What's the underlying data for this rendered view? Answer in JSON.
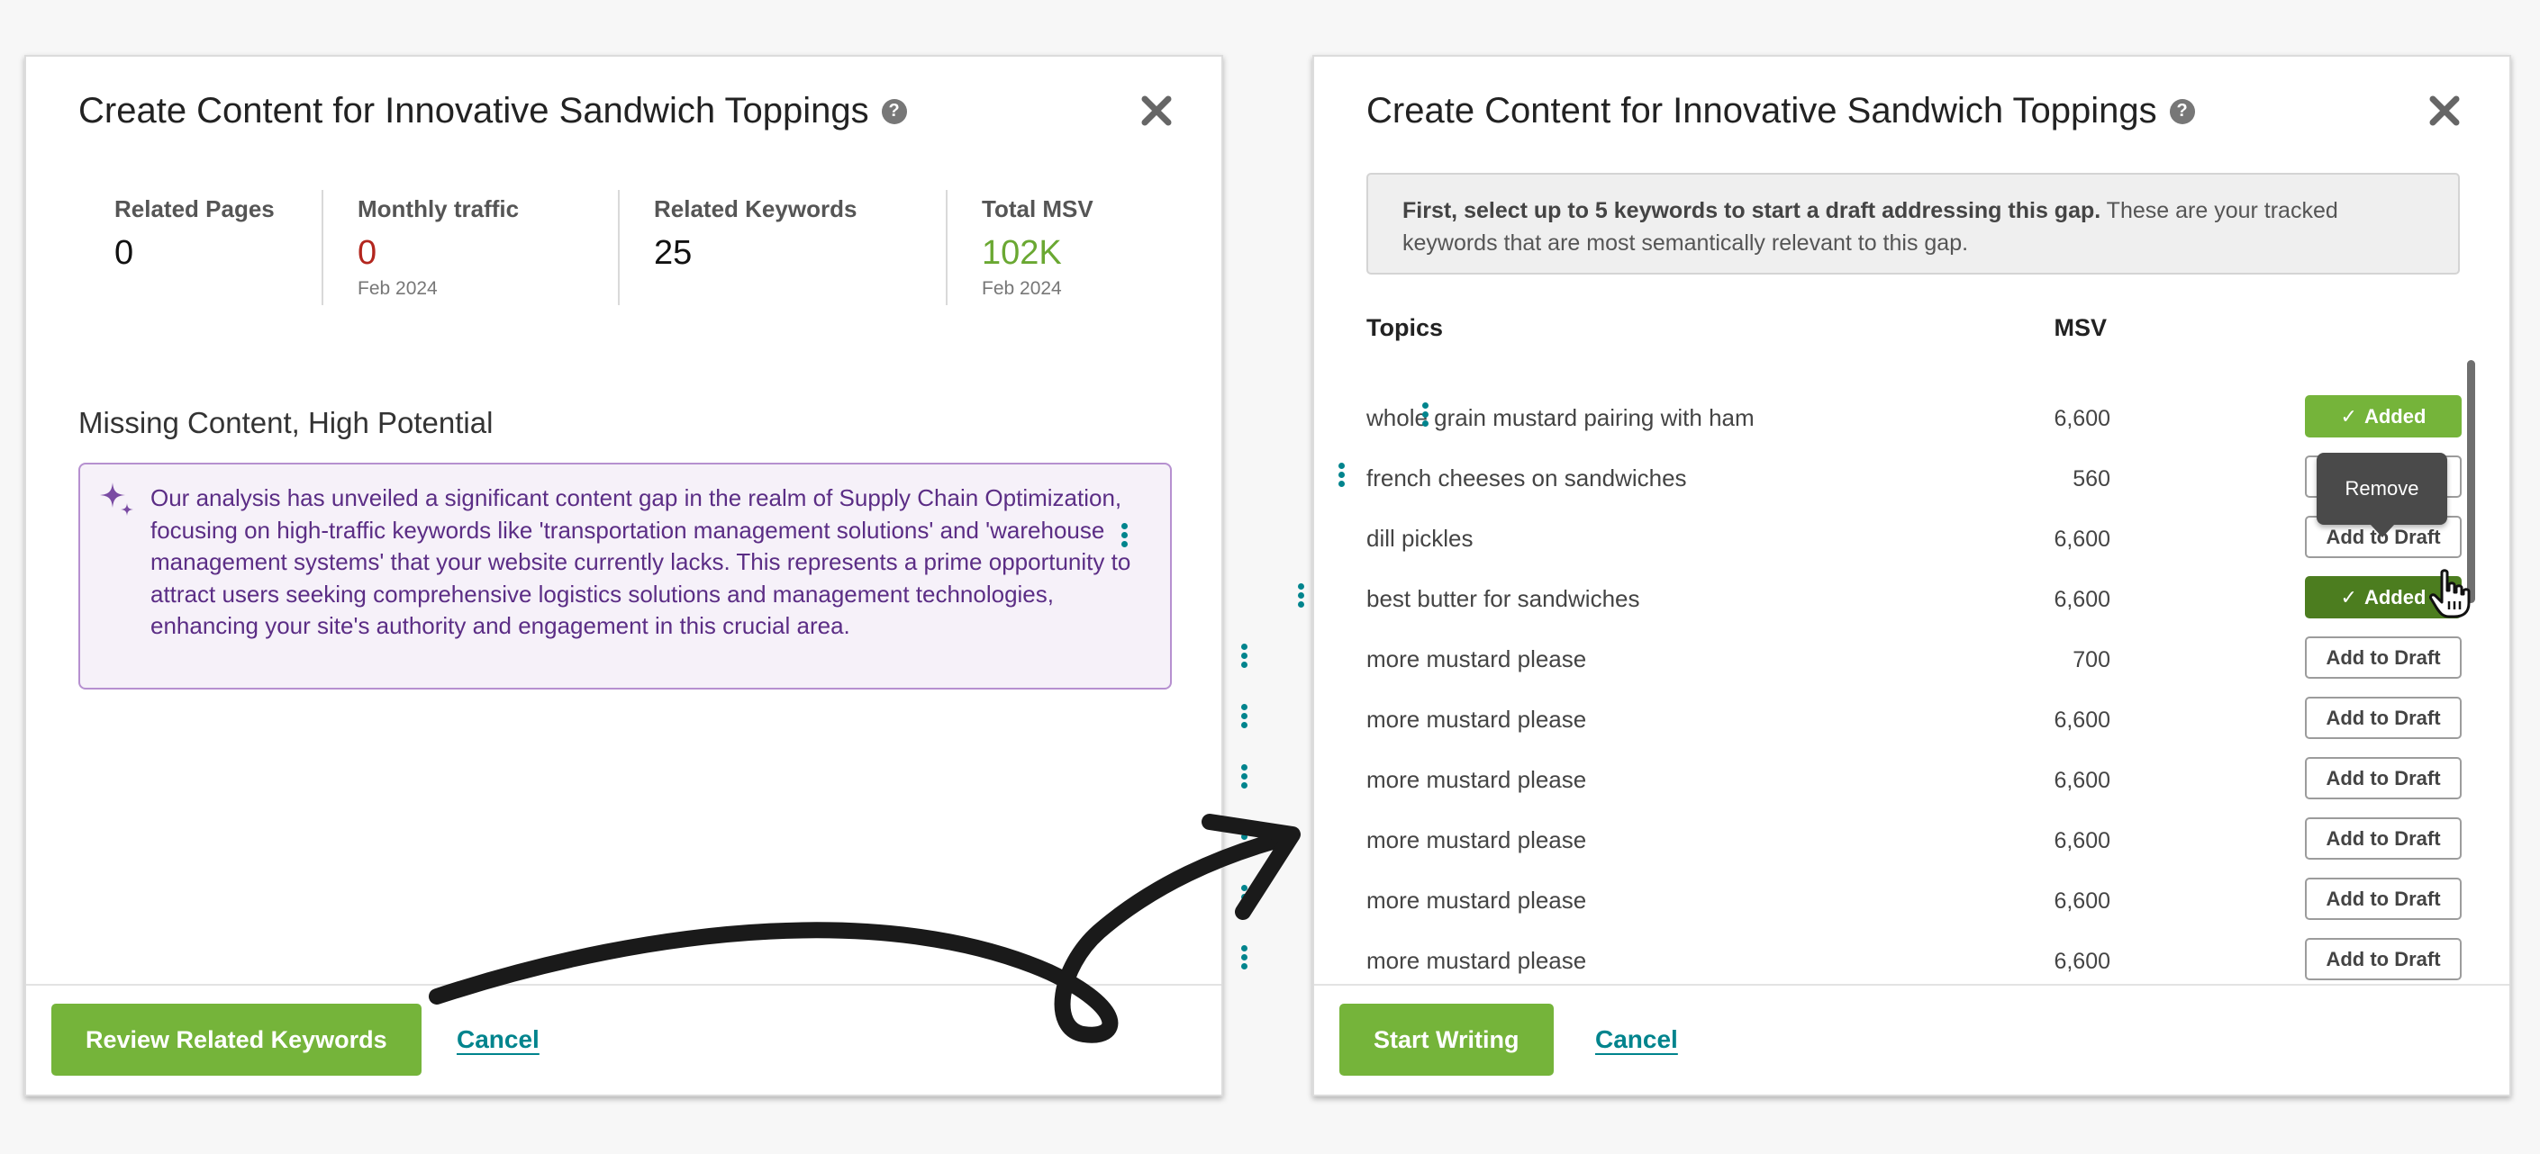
{
  "left_modal": {
    "title": "Create Content for Innovative Sandwich Toppings",
    "help": "?",
    "stats": [
      {
        "label": "Related Pages",
        "value": "0",
        "sub": ""
      },
      {
        "label": "Monthly traffic",
        "value": "0",
        "sub": "Feb 2024"
      },
      {
        "label": "Related Keywords",
        "value": "25",
        "sub": ""
      },
      {
        "label": "Total MSV",
        "value": "102K",
        "sub": "Feb 2024"
      }
    ],
    "section_title": "Missing Content, High Potential",
    "insight": "Our analysis has unveiled a significant content gap in the realm of Supply Chain Optimization, focusing on high-traffic keywords like 'transportation management solutions' and 'warehouse management systems' that your website currently lacks. This represents a prime opportunity to attract users seeking comprehensive logistics solutions and management technologies, enhancing your site's authority and engagement in this crucial area.",
    "primary_button": "Review Related Keywords",
    "cancel": "Cancel"
  },
  "right_modal": {
    "title": "Create Content for Innovative Sandwich Toppings",
    "help": "?",
    "info_bold": "First, select up to 5 keywords to start a draft addressing this gap.",
    "info_rest": " These are your tracked keywords that are most semantically relevant to this gap.",
    "col_topics": "Topics",
    "col_msv": "MSV",
    "rows": [
      {
        "topic": "whole grain mustard pairing with ham",
        "msv": "6,600",
        "action": "Added"
      },
      {
        "topic": "french cheeses on sandwiches",
        "msv": "560",
        "action": "Add to Draft"
      },
      {
        "topic": "dill pickles",
        "msv": "6,600",
        "action": "Add to Draft"
      },
      {
        "topic": "best butter for sandwiches",
        "msv": "6,600",
        "action": "Added"
      },
      {
        "topic": "more mustard please",
        "msv": "700",
        "action": "Add to Draft"
      },
      {
        "topic": "more mustard please",
        "msv": "6,600",
        "action": "Add to Draft"
      },
      {
        "topic": "more mustard please",
        "msv": "6,600",
        "action": "Add to Draft"
      },
      {
        "topic": "more mustard please",
        "msv": "6,600",
        "action": "Add to Draft"
      },
      {
        "topic": "more mustard please",
        "msv": "6,600",
        "action": "Add to Draft"
      },
      {
        "topic": "more mustard please",
        "msv": "6,600",
        "action": "Add to Draft"
      }
    ],
    "tooltip": "Remove",
    "primary_button": "Start Writing",
    "cancel": "Cancel"
  },
  "colors": {
    "accent_green": "#75b43a",
    "dark_green": "#4c7d1f",
    "link_teal": "#00848d",
    "traffic_red": "#b3261e",
    "msv_green": "#6aa832",
    "insight_purple": "#5b2d85"
  }
}
